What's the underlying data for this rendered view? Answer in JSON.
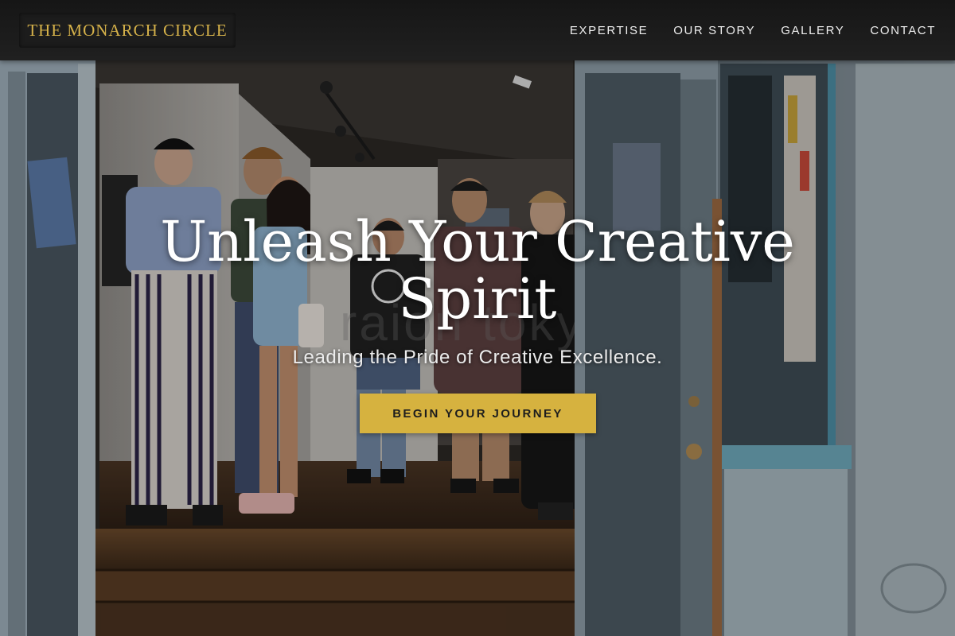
{
  "brand": {
    "name": "THE MONARCH CIRCLE"
  },
  "nav": {
    "links": [
      {
        "label": "EXPERTISE"
      },
      {
        "label": "OUR STORY"
      },
      {
        "label": "GALLERY"
      },
      {
        "label": "CONTACT"
      }
    ]
  },
  "hero": {
    "title_line1": "Unleash Your Creative",
    "title_line2": "Spirit",
    "subtitle": "Leading the Pride of Creative Excellence.",
    "cta_label": "BEGIN YOUR JOURNEY",
    "background_watermark": "raion tokyo"
  },
  "colors": {
    "accent_gold": "#d6b23f",
    "nav_background": "#1b1b1b",
    "hero_text": "#ffffff"
  }
}
